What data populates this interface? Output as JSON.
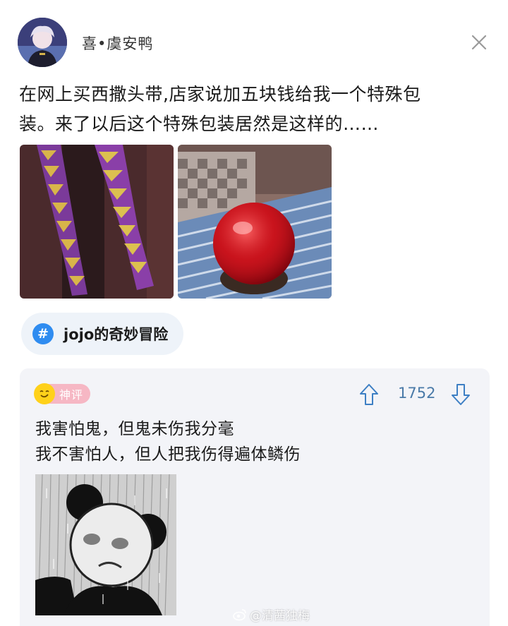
{
  "header": {
    "username": "喜•虞安鸭"
  },
  "post": {
    "text_line1": "在网上买西撒头带,店家说加五块钱给我一个特殊包",
    "text_line2": "装。来了以后这个特殊包装居然是这样的……"
  },
  "topic": {
    "hash": "#",
    "label": "jojo的奇妙冒险"
  },
  "comment": {
    "badge": "神评",
    "votes": "1752",
    "line1": "我害怕鬼，但鬼未伤我分毫",
    "line2": "我不害怕人，但人把我伤得遍体鳞伤"
  },
  "watermark": {
    "text": "@清茜独梅"
  },
  "colors": {
    "accent_blue": "#2f8cf0",
    "vote_blue": "#4a7aa8",
    "badge_pink": "#f6b7c4",
    "card_bg": "#f3f4f8",
    "chip_bg": "#eef3f9"
  }
}
